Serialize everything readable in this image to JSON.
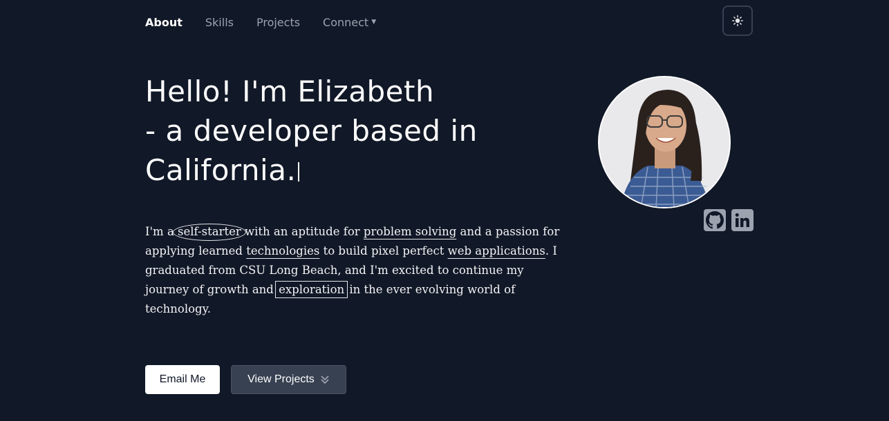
{
  "nav": {
    "items": [
      {
        "label": "About",
        "active": true
      },
      {
        "label": "Skills",
        "active": false
      },
      {
        "label": "Projects",
        "active": false
      },
      {
        "label": "Connect",
        "active": false,
        "has_dropdown": true
      }
    ],
    "theme_toggle_icon": "sun-icon"
  },
  "hero": {
    "heading_line1": "Hello! I'm Elizabeth",
    "heading_line2": "- a developer based in",
    "heading_line3": "California."
  },
  "bio": {
    "t1": "I'm a ",
    "h1": "self-starter",
    "t2": " with an aptitude for ",
    "h2": "problem solving",
    "t3": " and a passion for applying learned ",
    "h3": "technologies",
    "t4": " to build pixel perfect ",
    "h4": "web applications",
    "t5": ". I graduated from CSU Long Beach, and I'm excited to continue my journey of growth and ",
    "h5": "exploration",
    "t6": " in the ever evolving world of technology."
  },
  "buttons": {
    "email_label": "Email Me",
    "projects_label": "View Projects",
    "projects_icon": "chevron-double-down-icon"
  },
  "profile": {
    "avatar_icon": "profile-photo",
    "social": [
      {
        "icon": "github-icon"
      },
      {
        "icon": "linkedin-icon"
      }
    ]
  },
  "colors": {
    "background": "#111827",
    "text": "#ffffff",
    "nav_inactive": "#9ca3af",
    "secondary_button": "#374151"
  }
}
